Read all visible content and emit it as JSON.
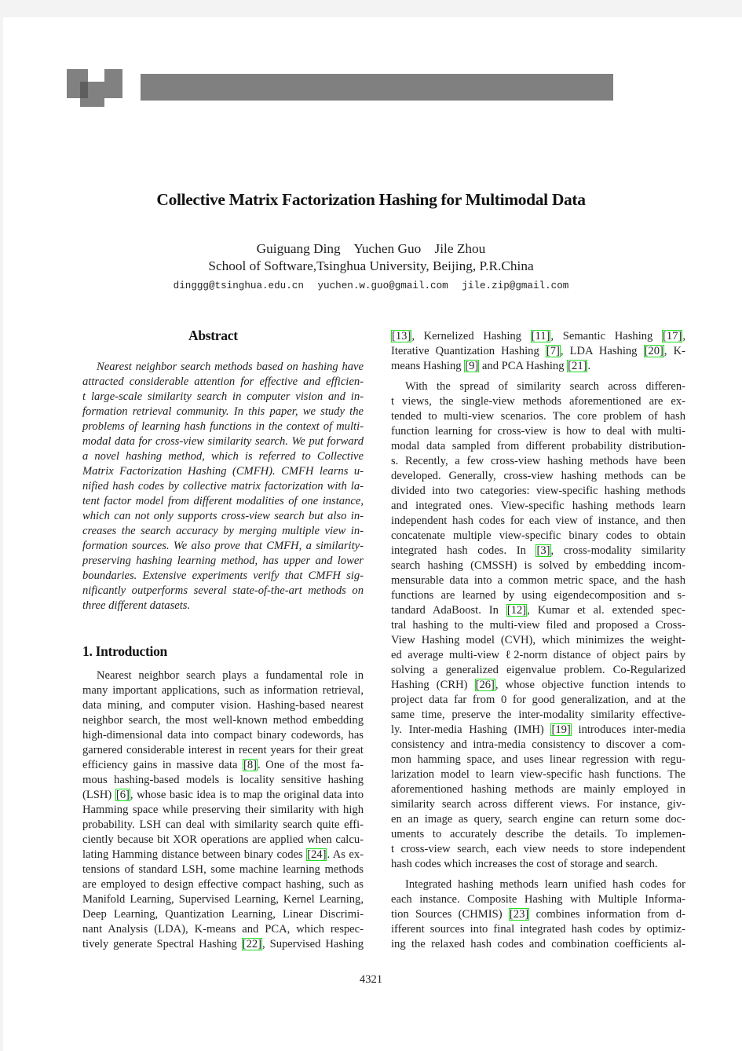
{
  "paper": {
    "title": "Collective Matrix Factorization Hashing for Multimodal Data",
    "authors": "Guiguang Ding    Yuchen Guo    Jile Zhou",
    "affiliation": "School of Software,Tsinghua University, Beijing, P.R.China",
    "emails": [
      "dinggg@tsinghua.edu.cn",
      "yuchen.w.guo@gmail.com",
      "jile.zip@gmail.com"
    ],
    "page_number": "4321"
  },
  "abstract": {
    "heading": "Abstract",
    "lines": [
      "Nearest neighbor search methods based on hashing have",
      "attracted considerable attention for effective and efficien-",
      "t large-scale similarity search in computer vision and in-",
      "formation retrieval community. In this paper, we study the",
      "problems of learning hash functions in the context of multi-",
      "modal data for cross-view similarity search. We put forward",
      "a novel hashing method, which is referred to Collective",
      "Matrix Factorization Hashing (CMFH). CMFH learns u-",
      "nified hash codes by collective matrix factorization with la-",
      "tent factor model from different modalities of one instance,",
      "which can not only supports cross-view search but also in-",
      "creases the search accuracy by merging multiple view in-",
      "formation sources. We also prove that CMFH, a similarity-",
      "preserving hashing learning method, has upper and lower",
      "boundaries. Extensive experiments verify that CMFH sig-",
      "nificantly outperforms several state-of-the-art methods on",
      "three different datasets."
    ]
  },
  "introduction": {
    "heading": "1. Introduction",
    "left_lines": [
      [
        "Nearest neighbor search plays a fundamental role in"
      ],
      [
        "many important applications, such as information retrieval,"
      ],
      [
        "data mining, and computer vision. Hashing-based nearest"
      ],
      [
        "neighbor search, the most well-known method embedding"
      ],
      [
        "high-dimensional data into compact binary codewords, has"
      ],
      [
        "garnered considerable interest in recent years for their great"
      ],
      [
        "efficiency gains in massive data ",
        {
          "cite": "[8]"
        },
        ". One of the most fa-"
      ],
      [
        "mous hashing-based models is locality sensitive hashing"
      ],
      [
        "(LSH) ",
        {
          "cite": "[6]"
        },
        ", whose basic idea is to map the original data into"
      ],
      [
        "Hamming space while preserving their similarity with high"
      ],
      [
        "probability. LSH can deal with similarity search quite effi-"
      ],
      [
        "ciently because bit XOR operations are applied when calcu-"
      ],
      [
        "lating Hamming distance between binary codes ",
        {
          "cite": "[24]"
        },
        ". As ex-"
      ],
      [
        "tensions of standard LSH, some machine learning methods"
      ],
      [
        "are employed to design effective compact hashing, such as"
      ],
      [
        "Manifold Learning, Supervised Learning, Kernel Learning,"
      ],
      [
        "Deep Learning, Quantization Learning, Linear Discrimi-"
      ],
      [
        "nant Analysis (LDA), K-means and PCA, which respec-"
      ],
      [
        "tively generate Spectral Hashing ",
        {
          "cite": "[22]"
        },
        ", Supervised Hashing"
      ]
    ],
    "right_para1": [
      [
        {
          "cite": "[13]"
        },
        ", Kernelized Hashing ",
        {
          "cite": "[11]"
        },
        ", Semantic Hashing ",
        {
          "cite": "[17]"
        },
        ","
      ],
      [
        "Iterative Quantization Hashing ",
        {
          "cite": "[7]"
        },
        ", LDA Hashing ",
        {
          "cite": "[20]"
        },
        ", K-"
      ],
      [
        "means Hashing ",
        {
          "cite": "[9]"
        },
        " and PCA Hashing ",
        {
          "cite": "[21]"
        },
        "."
      ]
    ],
    "right_para2": [
      [
        "With the spread of similarity search across differen-"
      ],
      [
        "t views, the single-view methods aforementioned are ex-"
      ],
      [
        "tended to multi-view scenarios. The core problem of hash"
      ],
      [
        "function learning for cross-view is how to deal with multi-"
      ],
      [
        "modal data sampled from different probability distribution-"
      ],
      [
        "s. Recently, a few cross-view hashing methods have been"
      ],
      [
        "developed. Generally, cross-view hashing methods can be"
      ],
      [
        "divided into two categories: view-specific hashing methods"
      ],
      [
        "and integrated ones. View-specific hashing methods learn"
      ],
      [
        "independent hash codes for each view of instance, and then"
      ],
      [
        "concatenate multiple view-specific binary codes to obtain"
      ],
      [
        "integrated hash codes. In ",
        {
          "cite": "[3]"
        },
        ", cross-modality similarity"
      ],
      [
        "search hashing (CMSSH) is solved by embedding incom-"
      ],
      [
        "mensurable data into a common metric space, and the hash"
      ],
      [
        "functions are learned by using eigendecomposition and s-"
      ],
      [
        "tandard AdaBoost. In ",
        {
          "cite": "[12]"
        },
        ", Kumar et al. extended spec-"
      ],
      [
        "tral hashing to the multi-view filed and proposed a Cross-"
      ],
      [
        "View Hashing model (CVH), which minimizes the weight-"
      ],
      [
        "ed average multi-view ℓ2-norm distance of object pairs by"
      ],
      [
        "solving a generalized eigenvalue problem. Co-Regularized"
      ],
      [
        "Hashing (CRH) ",
        {
          "cite": "[26]"
        },
        ", whose objective function intends to"
      ],
      [
        "project data far from 0 for good generalization, and at the"
      ],
      [
        "same time, preserve the inter-modality similarity effective-"
      ],
      [
        "ly. Inter-media Hashing (IMH) ",
        {
          "cite": "[19]"
        },
        " introduces inter-media"
      ],
      [
        "consistency and intra-media consistency to discover a com-"
      ],
      [
        "mon hamming space, and uses linear regression with regu-"
      ],
      [
        "larization model to learn view-specific hash functions. The"
      ],
      [
        "aforementioned hashing methods are mainly employed in"
      ],
      [
        "similarity search across different views. For instance, giv-"
      ],
      [
        "en an image as query, search engine can return some doc-"
      ],
      [
        "uments to accurately describe the details. To implemen-"
      ],
      [
        "t cross-view search, each view needs to store independent"
      ],
      [
        "hash codes which increases the cost of storage and search."
      ]
    ],
    "right_para3": [
      [
        "Integrated hashing methods learn unified hash codes for"
      ],
      [
        "each instance. Composite Hashing with Multiple Informa-"
      ],
      [
        "tion Sources (CHMIS) ",
        {
          "cite": "[23]"
        },
        " combines information from d-"
      ],
      [
        "ifferent sources into final integrated hash codes by optimiz-"
      ],
      [
        "ing the relaxed hash codes and combination coefficients al-"
      ]
    ]
  },
  "colors": {
    "citation_box": "#22dd22",
    "header_bar": "#808080",
    "viewer_background": "#f3f3f3"
  }
}
